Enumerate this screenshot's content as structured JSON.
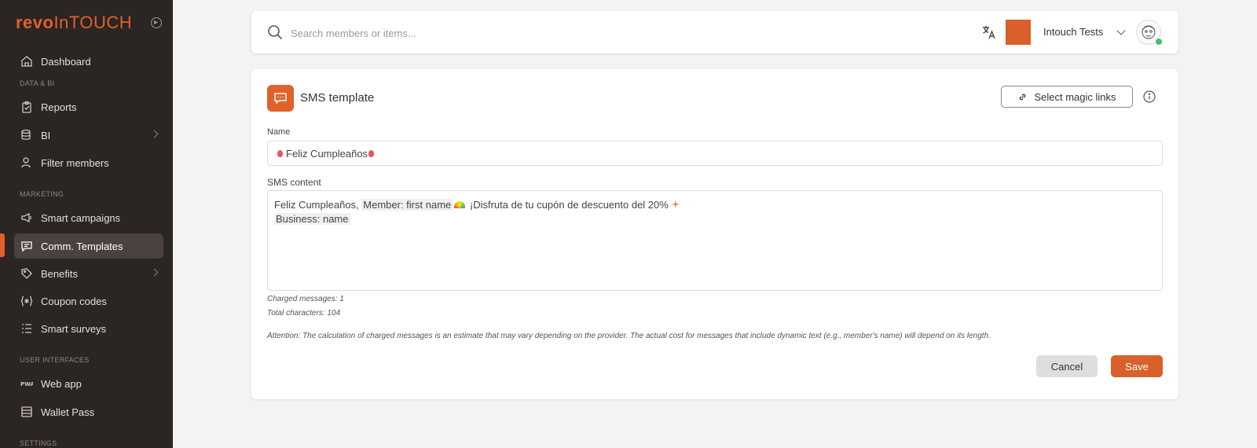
{
  "sidebar": {
    "logo_bold": "revo",
    "logo_light": "InTOUCH",
    "sections": {
      "data_bi": "DATA & BI",
      "marketing": "MARKETING",
      "user_interfaces": "USER INTERFACES",
      "settings": "SETTINGS"
    },
    "items": [
      {
        "label": "Dashboard",
        "icon": "home-icon"
      },
      {
        "label": "Reports",
        "icon": "clipboard-icon"
      },
      {
        "label": "BI",
        "icon": "database-icon"
      },
      {
        "label": "Filter members",
        "icon": "user-filter-icon"
      },
      {
        "label": "Smart campaigns",
        "icon": "megaphone-icon"
      },
      {
        "label": "Comm. Templates",
        "icon": "message-icon",
        "active": true
      },
      {
        "label": "Benefits",
        "icon": "tag-icon"
      },
      {
        "label": "Coupon codes",
        "icon": "braces-asterisk-icon"
      },
      {
        "label": "Smart surveys",
        "icon": "list-icon"
      },
      {
        "label": "Web app",
        "icon": "pwa-icon"
      },
      {
        "label": "Wallet Pass",
        "icon": "wallet-icon"
      }
    ],
    "accent": "#e0622a"
  },
  "topbar": {
    "search_placeholder": "Search members or items...",
    "org_name": "Intouch Tests"
  },
  "card": {
    "title": "SMS template",
    "magic_links_label": "Select magic links",
    "name_label": "Name",
    "name_value": "Feliz Cumpleaños",
    "content_label": "SMS content",
    "content_line1_pre": "Feliz Cumpleaños, ",
    "content_tag1": "Member: first name",
    "content_line1_post": " ¡Disfruta de tu cupón de descuento del 20%",
    "content_tag2": "Business: name",
    "charged_messages": "Charged messages: 1",
    "total_characters": "Total characters: 104",
    "attention": "Attention: The calculation of charged messages is an estimate that may vary depending on the provider. The actual cost for messages that include dynamic text (e.g., member's name) will depend on its length.",
    "cancel_label": "Cancel",
    "save_label": "Save"
  }
}
